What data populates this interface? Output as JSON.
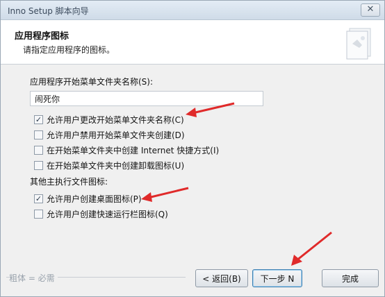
{
  "window": {
    "title": "Inno Setup 脚本向导",
    "close_glyph": "✕"
  },
  "header": {
    "title": "应用程序图标",
    "subtitle": "请指定应用程序的图标。"
  },
  "form": {
    "folder_label": "应用程序开始菜单文件夹名称(S):",
    "folder_value": "闹死你",
    "options": [
      {
        "label": "允许用户更改开始菜单文件夹名称(C)",
        "checked": true
      },
      {
        "label": "允许用户禁用开始菜单文件夹创建(D)",
        "checked": false
      },
      {
        "label": "在开始菜单文件夹中创建 Internet 快捷方式(I)",
        "checked": false
      },
      {
        "label": "在开始菜单文件夹中创建卸载图标(U)",
        "checked": false
      }
    ],
    "other_label": "其他主执行文件图标:",
    "other_options": [
      {
        "label": "允许用户创建桌面图标(P)",
        "checked": true
      },
      {
        "label": "允许用户创建快速运行栏图标(Q)",
        "checked": false
      }
    ]
  },
  "footer": {
    "text": "粗体 = 必需",
    "back_label": "< 返回(B)",
    "next_label": "下一步 N",
    "finish_label": "完成"
  },
  "colors": {
    "arrow": "#e02a2a"
  }
}
